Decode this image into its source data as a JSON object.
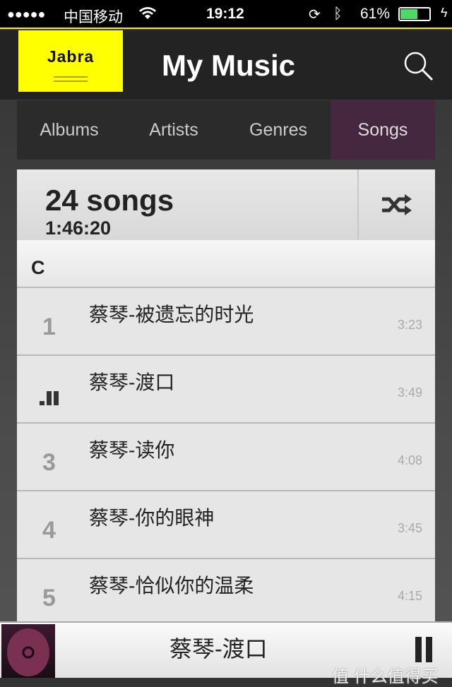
{
  "status": {
    "signal": "●●●●●",
    "carrier": "中国移动",
    "time": "19:12",
    "battery": "61%",
    "battery_level": 0.61,
    "icons": [
      "wifi-icon",
      "rotation-lock-icon",
      "bluetooth-icon",
      "battery-icon",
      "charging-icon"
    ]
  },
  "header": {
    "logo": "Jabra",
    "title": "My Music",
    "search_icon": "search-icon"
  },
  "tabs": [
    {
      "label": "Albums"
    },
    {
      "label": "Artists"
    },
    {
      "label": "Genres"
    },
    {
      "label": "Songs",
      "active": true
    }
  ],
  "summary": {
    "count": "24 songs",
    "duration": "1:46:20",
    "shuffle_icon": "shuffle-icon"
  },
  "section": "C",
  "songs": [
    {
      "num": "1",
      "title": "蔡琴-被遗忘的时光",
      "time": "3:23"
    },
    {
      "num": "",
      "title": "蔡琴-渡口",
      "time": "3:49",
      "playing": true
    },
    {
      "num": "3",
      "title": "蔡琴-读你",
      "time": "4:08"
    },
    {
      "num": "4",
      "title": "蔡琴-你的眼神",
      "time": "3:45"
    },
    {
      "num": "5",
      "title": "蔡琴-恰似你的温柔",
      "time": "4:15"
    }
  ],
  "now_playing": {
    "title": "蔡琴-渡口",
    "state": "playing"
  },
  "watermark": "值 什么值得买",
  "colors": {
    "accent": "#ffff00",
    "active_tab": "#45283f",
    "battery": "#4cd964"
  }
}
